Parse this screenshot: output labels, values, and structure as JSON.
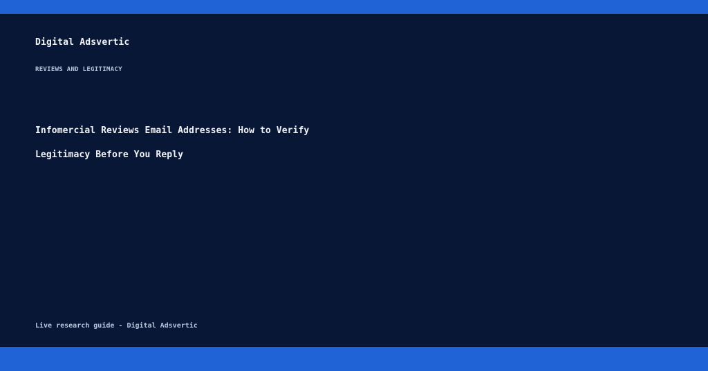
{
  "brand": {
    "name": "Digital Adsvertic"
  },
  "article": {
    "category": "REVIEWS AND LEGITIMACY",
    "title": "Infomercial Reviews Email Addresses: How to Verify Legitimacy Before You Reply"
  },
  "footer": {
    "note": "Live research guide - Digital Adsvertic"
  },
  "colors": {
    "background": "#081736",
    "accent_bar": "#1f63d6",
    "text_primary": "#f2f4f8",
    "text_secondary": "#b7c4dc"
  }
}
